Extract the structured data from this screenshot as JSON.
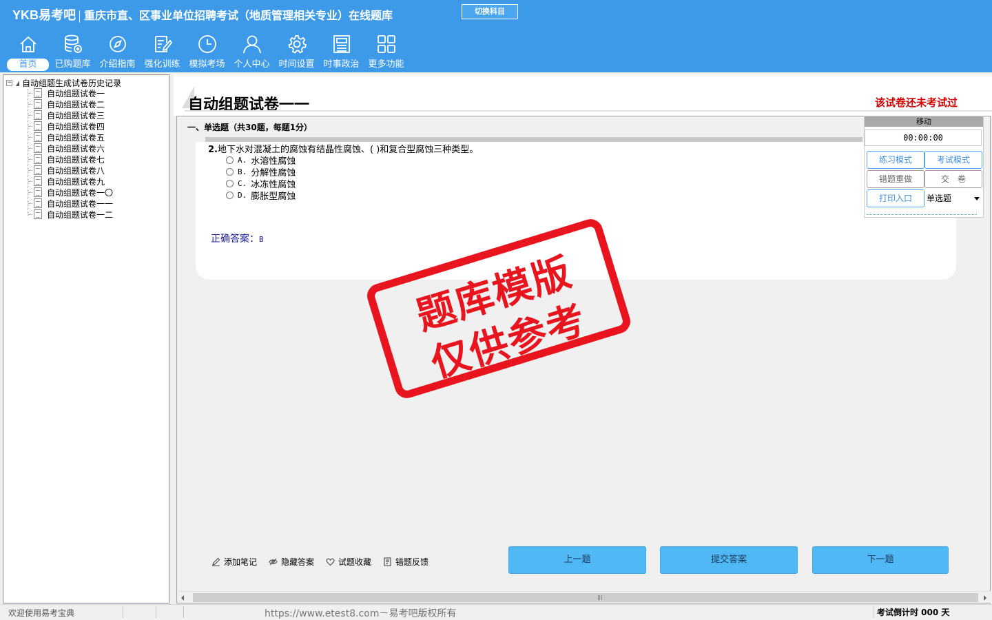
{
  "header": {
    "brand": "YKB易考吧",
    "title": "重庆市直、区事业单位招聘考试（地质管理相关专业）在线题库",
    "switch_label": "切换科目",
    "bg_color": "#3d9ae8"
  },
  "nav": [
    {
      "label": "首页",
      "icon": "home-icon",
      "active": true
    },
    {
      "label": "已购题库",
      "icon": "database-icon"
    },
    {
      "label": "介绍指南",
      "icon": "compass-icon"
    },
    {
      "label": "强化训练",
      "icon": "edit-icon"
    },
    {
      "label": "模拟考场",
      "icon": "clock-icon"
    },
    {
      "label": "个人中心",
      "icon": "user-icon"
    },
    {
      "label": "时间设置",
      "icon": "gear-icon"
    },
    {
      "label": "时事政治",
      "icon": "newspaper-icon"
    },
    {
      "label": "更多功能",
      "icon": "grid-icon"
    }
  ],
  "tree": {
    "root": "自动组题生成试卷历史记录",
    "items": [
      "自动组题试卷一",
      "自动组题试卷二",
      "自动组题试卷三",
      "自动组题试卷四",
      "自动组题试卷五",
      "自动组题试卷六",
      "自动组题试卷七",
      "自动组题试卷八",
      "自动组题试卷九",
      "自动组题试卷一〇",
      "自动组题试卷一一",
      "自动组题试卷一二"
    ]
  },
  "paper": {
    "title": "自动组题试卷一一",
    "status": "该试卷还未考试过",
    "section": "一、单选题（共30题，每题1分）"
  },
  "question": {
    "number": "2.",
    "text": "地下水对混凝土的腐蚀有结晶性腐蚀、( )和复合型腐蚀三种类型。",
    "options": [
      {
        "letter": "A.",
        "text": "水溶性腐蚀"
      },
      {
        "letter": "B.",
        "text": "分解性腐蚀"
      },
      {
        "letter": "C.",
        "text": "冰冻性腐蚀"
      },
      {
        "letter": "D.",
        "text": "膨胀型腐蚀"
      }
    ],
    "answer_label": "正确答案：",
    "answer_value": "B"
  },
  "stamp": {
    "line1": "题库模版",
    "line2": "仅供参考",
    "color": "#e8141e"
  },
  "control": {
    "header": "移动",
    "timer": "00:00:00",
    "practice_mode": "练习模式",
    "exam_mode": "考试模式",
    "redo_wrong": "错题重做",
    "submit_paper": "交　卷",
    "print_entry": "打印入口",
    "question_type": "单选题"
  },
  "tools": {
    "add_note": "添加笔记",
    "hide_answer": "隐藏答案",
    "favorite": "试题收藏",
    "feedback": "错题反馈"
  },
  "buttons": {
    "prev": "上一题",
    "submit": "提交答案",
    "next": "下一题"
  },
  "status": {
    "welcome": "欢迎使用易考宝典",
    "copyright": "https://www.etest8.com－易考吧版权所有",
    "countdown": "考试倒计时 000 天"
  }
}
